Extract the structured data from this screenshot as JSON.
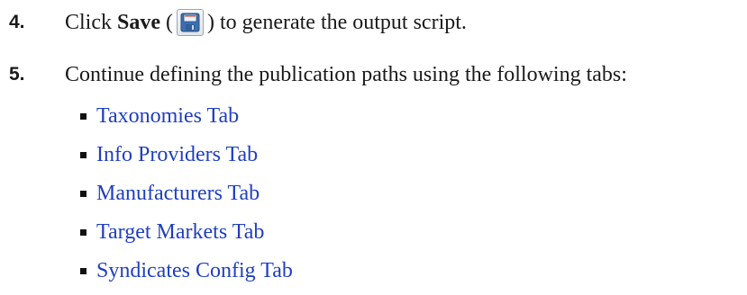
{
  "steps": [
    {
      "number": "4.",
      "prefix": "Click ",
      "bold": "Save",
      "open_paren": " (",
      "close_paren": ")",
      "suffix": " to generate the output script."
    },
    {
      "number": "5.",
      "text": "Continue defining the publication paths using the following tabs:"
    }
  ],
  "links": [
    "Taxonomies Tab",
    "Info Providers Tab",
    "Manufacturers Tab",
    "Target Markets Tab",
    "Syndicates Config Tab"
  ],
  "icons": {
    "save": "save-floppy-icon"
  },
  "colors": {
    "link": "#1f3fbf",
    "bullet": "#111111"
  }
}
